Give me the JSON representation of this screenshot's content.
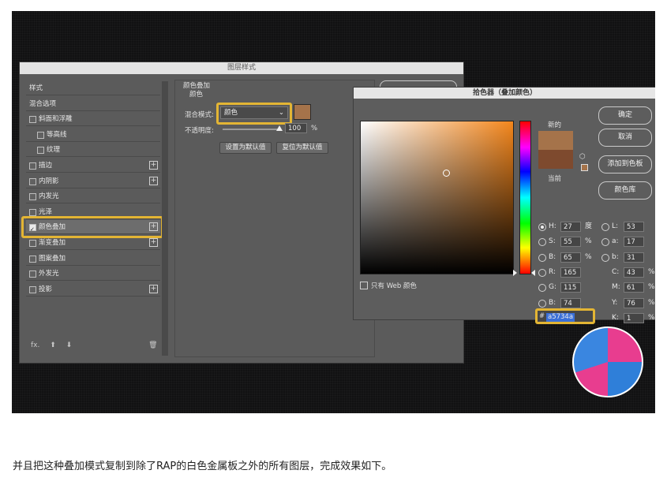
{
  "layer_style": {
    "title": "图层样式",
    "items": [
      {
        "label": "样式",
        "checkbox": false,
        "checked": false,
        "plus": false,
        "indent": 0
      },
      {
        "label": "混合选项",
        "checkbox": false,
        "checked": false,
        "plus": false,
        "indent": 0
      },
      {
        "label": "斜面和浮雕",
        "checkbox": true,
        "checked": false,
        "plus": false,
        "indent": 0
      },
      {
        "label": "等高线",
        "checkbox": true,
        "checked": false,
        "plus": false,
        "indent": 1
      },
      {
        "label": "纹理",
        "checkbox": true,
        "checked": false,
        "plus": false,
        "indent": 1
      },
      {
        "label": "描边",
        "checkbox": true,
        "checked": false,
        "plus": true,
        "indent": 0
      },
      {
        "label": "内阴影",
        "checkbox": true,
        "checked": false,
        "plus": true,
        "indent": 0
      },
      {
        "label": "内发光",
        "checkbox": true,
        "checked": false,
        "plus": false,
        "indent": 0
      },
      {
        "label": "光泽",
        "checkbox": true,
        "checked": false,
        "plus": false,
        "indent": 0
      },
      {
        "label": "颜色叠加",
        "checkbox": true,
        "checked": true,
        "plus": true,
        "indent": 0
      },
      {
        "label": "渐变叠加",
        "checkbox": true,
        "checked": false,
        "plus": true,
        "indent": 0
      },
      {
        "label": "图案叠加",
        "checkbox": true,
        "checked": false,
        "plus": false,
        "indent": 0
      },
      {
        "label": "外发光",
        "checkbox": true,
        "checked": false,
        "plus": false,
        "indent": 0
      },
      {
        "label": "投影",
        "checkbox": true,
        "checked": false,
        "plus": true,
        "indent": 0
      }
    ],
    "footer_fx": "fx.",
    "panel": {
      "heading": "颜色叠加",
      "subheading": "颜色",
      "blend_mode_label": "混合模式:",
      "blend_mode_value": "颜色",
      "opacity_label": "不透明度:",
      "opacity_value": "100",
      "opacity_unit": "%",
      "opacity_fraction": 1.0,
      "set_default": "设置为默认值",
      "reset_default": "复位为默认值"
    }
  },
  "color_picker": {
    "title": "拾色器（叠加颜色）",
    "new_label": "新的",
    "current_label": "当前",
    "buttons": {
      "ok": "确定",
      "cancel": "取消",
      "add_to_swatches": "添加到色板",
      "color_libraries": "颜色库"
    },
    "hsb": [
      {
        "label": "H:",
        "value": "27",
        "unit": "度",
        "selected": true
      },
      {
        "label": "S:",
        "value": "55",
        "unit": "%",
        "selected": false
      },
      {
        "label": "B:",
        "value": "65",
        "unit": "%",
        "selected": false
      }
    ],
    "rgb": [
      {
        "label": "R:",
        "value": "165"
      },
      {
        "label": "G:",
        "value": "115"
      },
      {
        "label": "B:",
        "value": "74"
      }
    ],
    "lab": [
      {
        "label": "L:",
        "value": "53"
      },
      {
        "label": "a:",
        "value": "17"
      },
      {
        "label": "b:",
        "value": "31"
      }
    ],
    "cmyk": [
      {
        "label": "C:",
        "value": "43",
        "unit": "%"
      },
      {
        "label": "M:",
        "value": "61",
        "unit": "%"
      },
      {
        "label": "Y:",
        "value": "76",
        "unit": "%"
      },
      {
        "label": "K:",
        "value": "1",
        "unit": "%"
      }
    ],
    "web_only_label": "只有 Web 颜色",
    "hex_symbol": "#",
    "hex_value": "a5734a",
    "new_color": "#a5734a",
    "current_color": "#7e4a2e"
  },
  "caption": "并且把这种叠加模式复制到除了RAP的白色金属板之外的所有图层，完成效果如下。",
  "colors": {
    "highlight": "#e3b534",
    "overlay_color": "#a5734a"
  }
}
